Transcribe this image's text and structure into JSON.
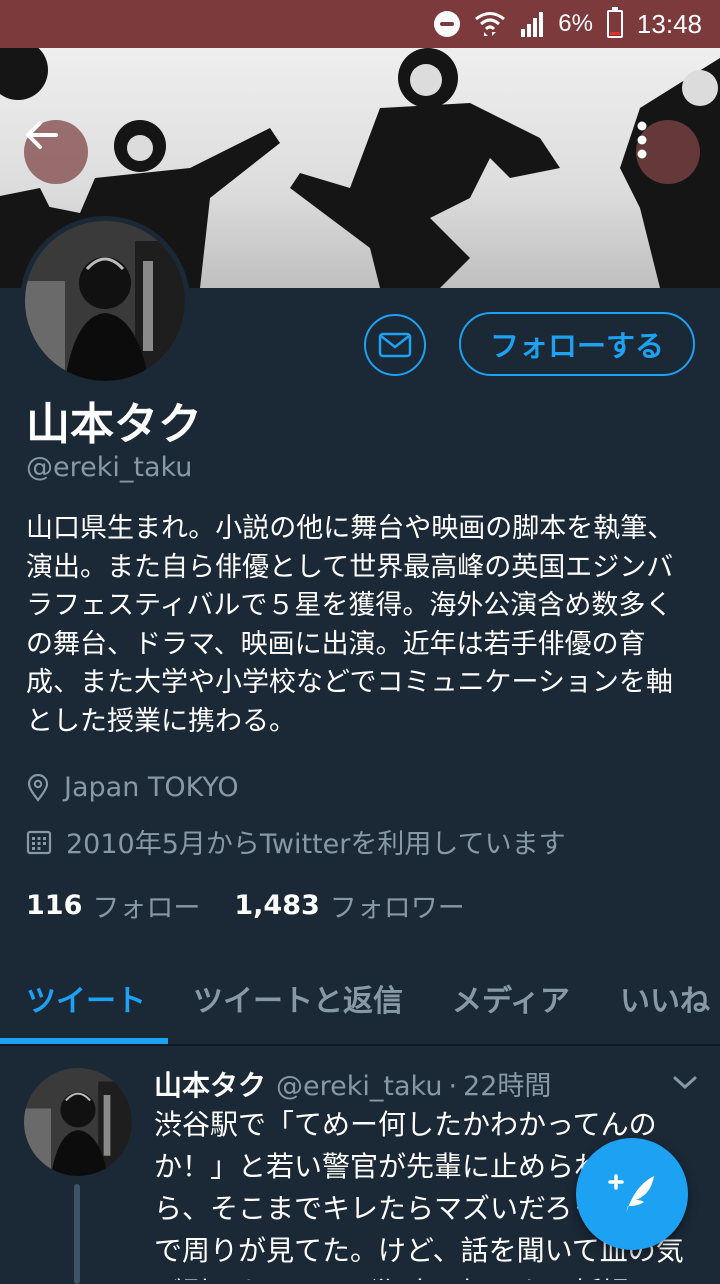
{
  "status_bar": {
    "battery_percent": "6%",
    "time": "13:48"
  },
  "profile": {
    "name": "山本タク",
    "handle": "@ereki_taku",
    "bio": "山口県生まれ。小説の他に舞台や映画の脚本を執筆、演出。また自ら俳優として世界最高峰の英国エジンバラフェスティバルで５星を獲得。海外公演含め数多くの舞台、ドラマ、映画に出演。近年は若手俳優の育成、また大学や小学校などでコミュニケーションを軸とした授業に携わる。",
    "location": "Japan TOKYO",
    "joined": "2010年5月からTwitterを利用しています",
    "following_count": "116",
    "following_label": "フォロー",
    "followers_count": "1,483",
    "followers_label": "フォロワー",
    "follow_button": "フォローする"
  },
  "tabs": [
    {
      "label": "ツイート",
      "active": true
    },
    {
      "label": "ツイートと返信",
      "active": false
    },
    {
      "label": "メディア",
      "active": false
    },
    {
      "label": "いいね",
      "active": false
    }
  ],
  "tweet": {
    "name": "山本タク",
    "handle": "@ereki_taku",
    "separator": "·",
    "time": "22時間",
    "text": "渋谷駅で「てめー何したかわかってんのか！」と若い警官が先輩に止められながら、そこまでキレたらマズいだろって感じで周りが見てた。けど、話を聞いて血の気が引いたんだけど犯人は知らない妊婦"
  },
  "colors": {
    "background": "#1b2836",
    "accent": "#1da1f2",
    "secondary_text": "#8899a6",
    "status_bar": "#7d3a3c"
  },
  "icons": [
    "do-not-disturb-icon",
    "wifi-icon",
    "signal-icon",
    "battery-icon",
    "back-arrow-icon",
    "more-vertical-icon",
    "mail-icon",
    "location-pin-icon",
    "calendar-icon",
    "chevron-down-icon",
    "compose-tweet-icon"
  ]
}
